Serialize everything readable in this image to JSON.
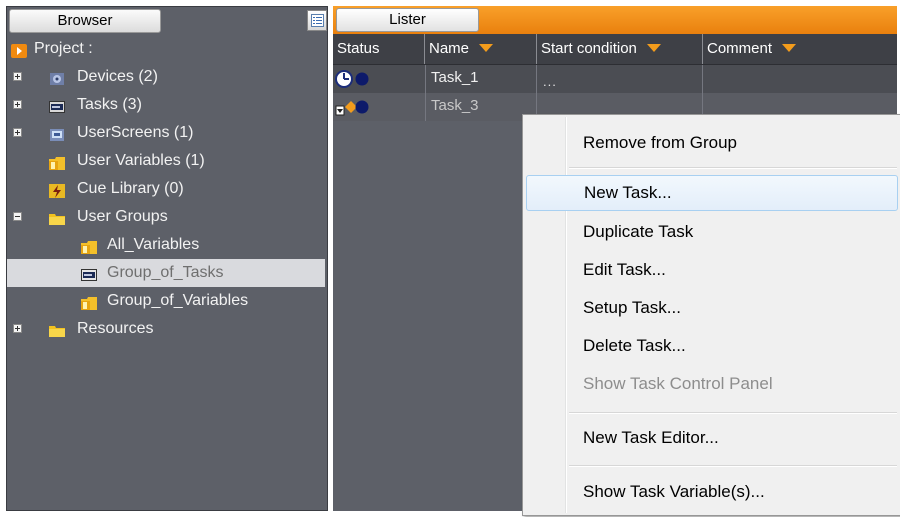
{
  "browser": {
    "tab_label": "Browser",
    "tree": [
      {
        "label": "Project :",
        "icon": "project-icon",
        "expander": "none",
        "indent": 0
      },
      {
        "label": "Devices (2)",
        "icon": "devices-icon",
        "expander": "plus",
        "indent": 1
      },
      {
        "label": "Tasks (3)",
        "icon": "tasks-icon",
        "expander": "plus",
        "indent": 1
      },
      {
        "label": "UserScreens (1)",
        "icon": "userscreens-icon",
        "expander": "plus",
        "indent": 1
      },
      {
        "label": "User Variables (1)",
        "icon": "user-variables-icon",
        "expander": "none",
        "indent": 1
      },
      {
        "label": "Cue Library (0)",
        "icon": "cue-library-icon",
        "expander": "none",
        "indent": 1
      },
      {
        "label": "User Groups",
        "icon": "folder-icon",
        "expander": "minus",
        "indent": 1
      },
      {
        "label": "All_Variables",
        "icon": "variables-group-icon",
        "expander": "none",
        "indent": 2
      },
      {
        "label": "Group_of_Tasks",
        "icon": "tasks-group-icon",
        "expander": "none",
        "indent": 2,
        "selected": true
      },
      {
        "label": "Group_of_Variables",
        "icon": "variables-group-icon",
        "expander": "none",
        "indent": 2
      },
      {
        "label": "Resources",
        "icon": "folder-icon",
        "expander": "plus",
        "indent": 1
      }
    ]
  },
  "lister": {
    "tab_label": "Lister",
    "columns": {
      "status": "Status",
      "name": "Name",
      "start_condition": "Start condition",
      "comment": "Comment"
    },
    "rows": [
      {
        "name": "Task_1",
        "start_condition": "...",
        "status_icon": "clock-task-icon"
      },
      {
        "name": "Task_3",
        "start_condition": "",
        "status_icon": "manual-task-icon"
      }
    ]
  },
  "context_menu": {
    "items": [
      {
        "label": "Remove from Group",
        "state": "normal"
      },
      {
        "label": "New Task...",
        "state": "hover"
      },
      {
        "label": "Duplicate Task",
        "state": "normal"
      },
      {
        "label": "Edit Task...",
        "state": "normal"
      },
      {
        "label": "Setup Task...",
        "state": "normal"
      },
      {
        "label": "Delete Task...",
        "state": "normal"
      },
      {
        "label": "Show Task Control Panel",
        "state": "disabled"
      },
      {
        "label": "New Task Editor...",
        "state": "normal"
      },
      {
        "label": "Show Task Variable(s)...",
        "state": "normal"
      }
    ]
  },
  "colors": {
    "panel_bg": "#5d6068",
    "lister_header": "#f39320",
    "selection_bg": "#d9dade",
    "menu_hover_border": "#a8d0f1"
  }
}
